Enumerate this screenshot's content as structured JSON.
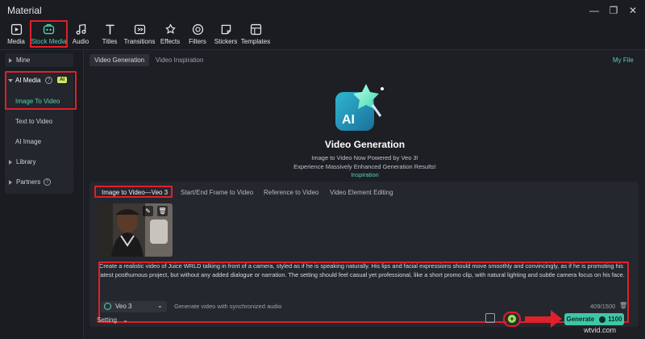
{
  "window": {
    "title": "Material"
  },
  "toolbar": {
    "items": [
      {
        "label": "Media",
        "icon": "media-icon"
      },
      {
        "label": "Stock Media",
        "icon": "stock-media-icon"
      },
      {
        "label": "Audio",
        "icon": "audio-icon"
      },
      {
        "label": "Titles",
        "icon": "titles-icon"
      },
      {
        "label": "Transitions",
        "icon": "transitions-icon"
      },
      {
        "label": "Effects",
        "icon": "effects-icon"
      },
      {
        "label": "Filters",
        "icon": "filters-icon"
      },
      {
        "label": "Stickers",
        "icon": "stickers-icon"
      },
      {
        "label": "Templates",
        "icon": "templates-icon"
      }
    ],
    "active": "Stock Media"
  },
  "sidebar": {
    "mine": "Mine",
    "ai_media": "AI Media",
    "ai_badge": "AI",
    "image_to_video": "Image To Video",
    "text_to_video": "Text to Video",
    "ai_image": "AI Image",
    "library": "Library",
    "partners": "Partners"
  },
  "main": {
    "tabs": [
      "Video Generation",
      "Video Inspiration"
    ],
    "my_file": "My File",
    "hero": {
      "logo_text": "AI",
      "title": "Video Generation",
      "line1": "Image to Video Now Powered by Veo 3!",
      "line2": "Experience Massively Enhanced Generation Results!",
      "link": "Inspiration"
    }
  },
  "panel": {
    "tabs": [
      "Image to Video—Veo 3",
      "Start/End Frame to Video",
      "Reference to Video",
      "Video Element Editing"
    ],
    "prompt": "Create a realistic video of Juice WRLD talking in front of a camera, styled as if he is speaking naturally. His lips and facial expressions should move smoothly and convincingly, as if he is promoting his latest posthumous project, but without any added dialogue or narration. The setting should feel casual yet professional, like a short promo clip, with natural lighting and subtle camera focus on his face.",
    "model": "Veo 3",
    "audio_hint": "Generate video with synchronized audio",
    "counter": "409/1500"
  },
  "footer": {
    "setting": "Setting",
    "generate": "Generate",
    "credits": "1100"
  },
  "watermark": "wtvid.com",
  "colors": {
    "accent": "#53d3b9",
    "highlight": "#e0202a",
    "button": "#3fc6a7"
  }
}
